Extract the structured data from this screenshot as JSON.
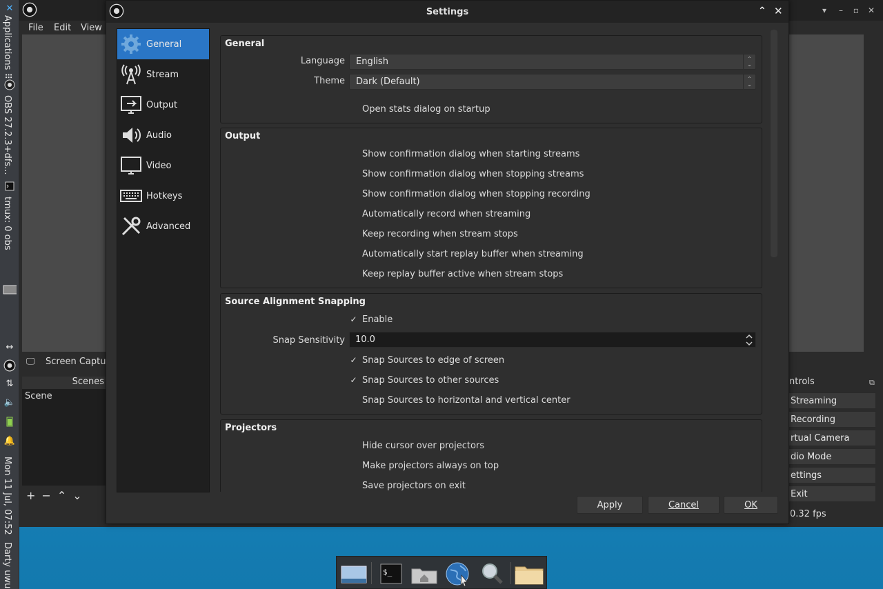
{
  "panel": {
    "applications": "Applications ⠿",
    "obs_task": "OBS 27.2.3+dfs...",
    "tmux_task": "tmux: 0 obs",
    "clock": "Mon 11 Jul, 07:52",
    "user": "Darty uwu"
  },
  "obs": {
    "menu": [
      "File",
      "Edit",
      "View"
    ],
    "source_label": "Screen Captu",
    "scenes_header": "Scenes",
    "scene_item": "Scene",
    "controls_header": "ntrols",
    "controls": [
      "Streaming",
      "Recording",
      "rtual Camera",
      "dio Mode",
      "ettings",
      "Exit"
    ],
    "fps": "0.32 fps"
  },
  "settings": {
    "title": "Settings",
    "nav": [
      {
        "label": "General",
        "icon": "gear-icon"
      },
      {
        "label": "Stream",
        "icon": "antenna-icon"
      },
      {
        "label": "Output",
        "icon": "monitor-output-icon"
      },
      {
        "label": "Audio",
        "icon": "speaker-icon"
      },
      {
        "label": "Video",
        "icon": "monitor-icon"
      },
      {
        "label": "Hotkeys",
        "icon": "keyboard-icon"
      },
      {
        "label": "Advanced",
        "icon": "tools-icon"
      }
    ],
    "general": {
      "title": "General",
      "language_label": "Language",
      "language_value": "English",
      "theme_label": "Theme",
      "theme_value": "Dark (Default)",
      "stats": "Open stats dialog on startup"
    },
    "output": {
      "title": "Output",
      "options": [
        "Show confirmation dialog when starting streams",
        "Show confirmation dialog when stopping streams",
        "Show confirmation dialog when stopping recording",
        "Automatically record when streaming",
        "Keep recording when stream stops",
        "Automatically start replay buffer when streaming",
        "Keep replay buffer active when stream stops"
      ]
    },
    "snapping": {
      "title": "Source Alignment Snapping",
      "enable": "Enable",
      "sensitivity_label": "Snap Sensitivity",
      "sensitivity_value": "10.0",
      "edge": "Snap Sources to edge of screen",
      "other": "Snap Sources to other sources",
      "center": "Snap Sources to horizontal and vertical center"
    },
    "projectors": {
      "title": "Projectors",
      "options": [
        "Hide cursor over projectors",
        "Make projectors always on top",
        "Save projectors on exit"
      ]
    },
    "buttons": {
      "apply": "Apply",
      "cancel": "Cancel",
      "ok": "OK"
    }
  }
}
